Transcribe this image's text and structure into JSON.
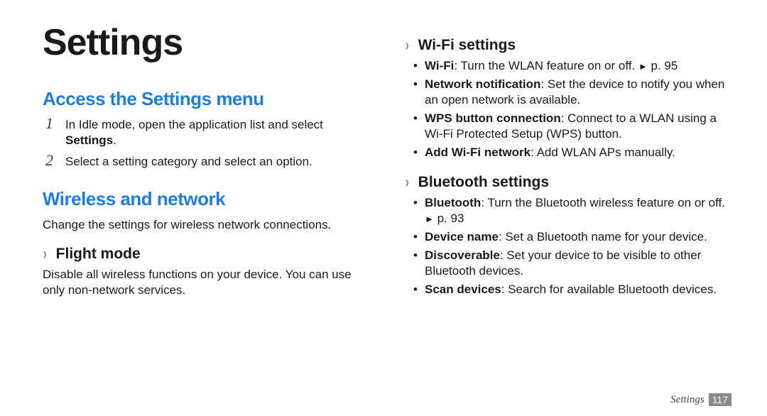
{
  "title": "Settings",
  "left": {
    "h2a": "Access the Settings menu",
    "steps": [
      {
        "num": "1",
        "pre": "In Idle mode, open the application list and select ",
        "bold": "Settings",
        "post": "."
      },
      {
        "num": "2",
        "pre": "Select a setting category and select an option.",
        "bold": "",
        "post": ""
      }
    ],
    "h2b": "Wireless and network",
    "wbody": "Change the settings for wireless network connections.",
    "flight": {
      "chev": "›",
      "title": "Flight mode",
      "body": "Disable all wireless functions on your device. You can use only non-network services."
    }
  },
  "right": {
    "wifi": {
      "chev": "›",
      "title": "Wi-Fi settings",
      "items": [
        {
          "bold": "Wi-Fi",
          "rest": ": Turn the WLAN feature on or off. ",
          "tri": "►",
          "pref": " p. 95"
        },
        {
          "bold": "Network notification",
          "rest": ": Set the device to notify you when an open network is available.",
          "tri": "",
          "pref": ""
        },
        {
          "bold": "WPS button connection",
          "rest": ": Connect to a WLAN using a Wi-Fi Protected Setup (WPS) button.",
          "tri": "",
          "pref": ""
        },
        {
          "bold": "Add Wi-Fi network",
          "rest": ": Add WLAN APs manually.",
          "tri": "",
          "pref": ""
        }
      ]
    },
    "bt": {
      "chev": "›",
      "title": "Bluetooth settings",
      "items": [
        {
          "bold": "Bluetooth",
          "rest": ": Turn the Bluetooth wireless feature on or off. ",
          "tri": "►",
          "pref": " p. 93"
        },
        {
          "bold": "Device name",
          "rest": ": Set a Bluetooth name for your device.",
          "tri": "",
          "pref": ""
        },
        {
          "bold": "Discoverable",
          "rest": ": Set your device to be visible to other Bluetooth devices.",
          "tri": "",
          "pref": ""
        },
        {
          "bold": "Scan devices",
          "rest": ": Search for available Bluetooth devices.",
          "tri": "",
          "pref": ""
        }
      ]
    }
  },
  "footer": {
    "label": "Settings",
    "page": "117"
  }
}
